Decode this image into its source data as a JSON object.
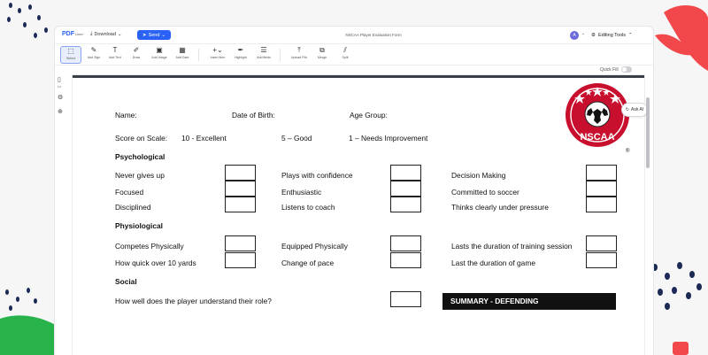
{
  "app": {
    "logo": "PDF",
    "logo_suffix": "Liner",
    "download_label": "Download",
    "send_label": "Send",
    "document_title": "NSCAA Player Evaluation Form",
    "avatar_letter": "A",
    "editing_tools_label": "Editing Tools",
    "quick_fill_label": "Quick Fill",
    "ask_ai_label": "Ask AI",
    "accent_color": "#2a62f5"
  },
  "toolbar": {
    "tools": [
      {
        "label": "Select",
        "icon": "select-icon"
      },
      {
        "label": "Add Sign",
        "icon": "sign-icon"
      },
      {
        "label": "Add Text",
        "icon": "text-icon"
      },
      {
        "label": "Draw",
        "icon": "draw-icon"
      },
      {
        "label": "Add Image",
        "icon": "image-icon"
      },
      {
        "label": "Add Date",
        "icon": "calendar-icon"
      },
      {
        "label": "Insert item",
        "icon": "insert-icon"
      },
      {
        "label": "Highlight",
        "icon": "highlight-icon"
      },
      {
        "label": "Add fields",
        "icon": "fields-icon"
      },
      {
        "label": "Upload File",
        "icon": "upload-icon"
      },
      {
        "label": "Merge",
        "icon": "merge-icon"
      },
      {
        "label": "Split",
        "icon": "split-icon"
      }
    ]
  },
  "leftrail": {
    "page_count": "1/4"
  },
  "form": {
    "name_label": "Name:",
    "dob_label": "Date of Birth:",
    "age_group_label": "Age Group:",
    "score_label": "Score on Scale:",
    "score_excellent": "10 - Excellent",
    "score_good": "5 – Good",
    "score_needs": "1 – Needs Improvement",
    "logo_text": "NSCAA",
    "psychological": {
      "heading": "Psychological",
      "col1": [
        "Never gives up",
        "Focused",
        "Disciplined"
      ],
      "col2": [
        "Plays with confidence",
        "Enthusiastic",
        "Listens to coach"
      ],
      "col3": [
        "Decision Making",
        "Committed to soccer",
        "Thinks clearly under pressure"
      ]
    },
    "physiological": {
      "heading": "Physiological",
      "col1": [
        "Competes Physically",
        "How quick over 10 yards"
      ],
      "col2": [
        "Equipped Physically",
        "Change of pace"
      ],
      "col3": [
        "Lasts the duration of training session",
        "Last the duration of game"
      ]
    },
    "social": {
      "heading": "Social",
      "question": "How well does the player understand their role?"
    },
    "summary_title": "SUMMARY - DEFENDING"
  }
}
